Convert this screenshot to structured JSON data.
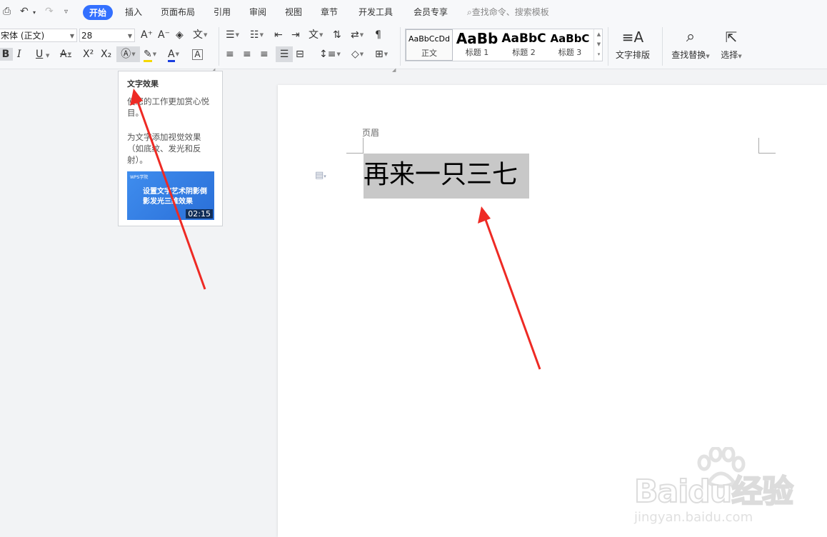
{
  "menubar": {
    "tabs": [
      "开始",
      "插入",
      "页面布局",
      "引用",
      "审阅",
      "视图",
      "章节",
      "开发工具",
      "会员专享"
    ],
    "search_placeholder": "查找命令、搜索模板"
  },
  "ribbon": {
    "font_name": "宋体 (正文)",
    "font_size": "28",
    "format_buttons": [
      "B",
      "I",
      "U",
      "X²",
      "X₂"
    ],
    "styles": [
      {
        "sample": "AaBbCcDd",
        "name": "正文"
      },
      {
        "sample": "AaBb",
        "name": "标题 1"
      },
      {
        "sample": "AaBbC",
        "name": "标题 2"
      },
      {
        "sample": "AaBbC",
        "name": "标题 3"
      }
    ],
    "text_layout_label": "文字排版",
    "find_replace_label": "查找替换",
    "select_label": "选择"
  },
  "tooltip": {
    "title": "文字效果",
    "text1": "使您的工作更加赏心悦目。",
    "text2": "为文字添加视觉效果（如底纹、发光和反射）。",
    "thumbnail_logo": "WPS学院",
    "thumbnail_title": "设置文字艺术阴影倒影发光三维效果",
    "thumbnail_duration": "02:15"
  },
  "document": {
    "header_label": "页眉",
    "body_text": "再来一只三七"
  },
  "watermark": {
    "brand": "Baidu经验",
    "url": "jingyan.baidu.com"
  },
  "colors": {
    "accent": "#3370ff",
    "arrow": "#ee2a24",
    "selection": "#c8c8c8",
    "highlight_yellow": "#f5d800",
    "font_color_blue": "#1a3fe0"
  }
}
